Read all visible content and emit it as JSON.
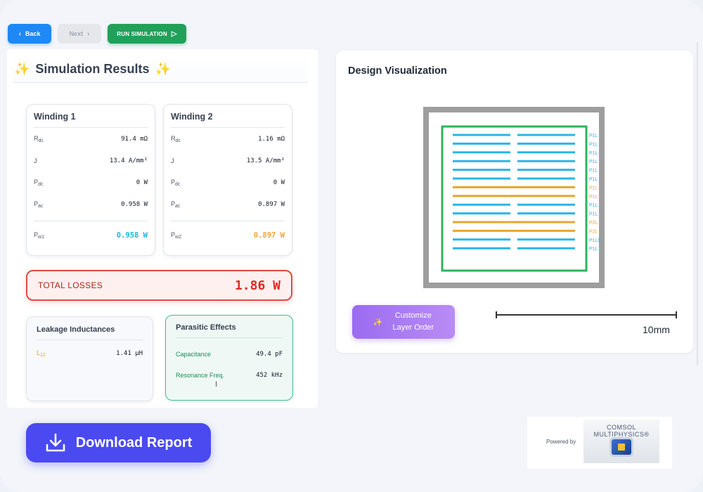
{
  "nav": {
    "back_label": "Back",
    "next_label": "Next",
    "run_label": "RUN SIMULATION"
  },
  "results": {
    "title": "Simulation Results",
    "winding1": {
      "title": "Winding 1",
      "rdc": "91.4 mΩ",
      "j": "13.4 A/mm²",
      "pdc": "0 W",
      "pac": "0.958 W",
      "pw": "0.958 W"
    },
    "winding2": {
      "title": "Winding 2",
      "rdc": "1.16 mΩ",
      "j": "13.5 A/mm²",
      "pdc": "0 W",
      "pac": "0.897 W",
      "pw": "0.897 W"
    },
    "labels": {
      "r": "R",
      "dc": "dc",
      "j": "J",
      "p": "P",
      "ac": "ac",
      "w1": "w1",
      "w2": "w2"
    },
    "total": {
      "label": "TOTAL LOSSES",
      "value": "1.86 W"
    },
    "leakage": {
      "title": "Leakage Inductances",
      "l_label": "L",
      "l_sub": "12",
      "l_value": "1.41 µH"
    },
    "parasitic": {
      "title": "Parasitic Effects",
      "cap_label": "Capacitance",
      "cap_value": "49.4 pF",
      "res_label": "Resonance Freq.",
      "res_value": "452 kHz"
    }
  },
  "design": {
    "title": "Design Visualization",
    "layer_labels": [
      "P1L",
      "P1L",
      "P1L",
      "P1L",
      "P1L",
      "P1L",
      "P1L",
      "P1L",
      "P1L",
      "P1L",
      "P2L",
      "P2L",
      "P1L0",
      "P1L"
    ],
    "customize_label_1": "Customize",
    "customize_label_2": "Layer Order",
    "scale_label": "10mm",
    "colors": {
      "core": "#9e9e9e",
      "bobbin": "#2db35d",
      "primary": "#29b6e8",
      "secondary": "#e8a531"
    }
  },
  "download_label": "Download Report",
  "comsol": {
    "powered_by": "Powered by",
    "brand": "COMSOL MULTIPHYSICS®"
  }
}
